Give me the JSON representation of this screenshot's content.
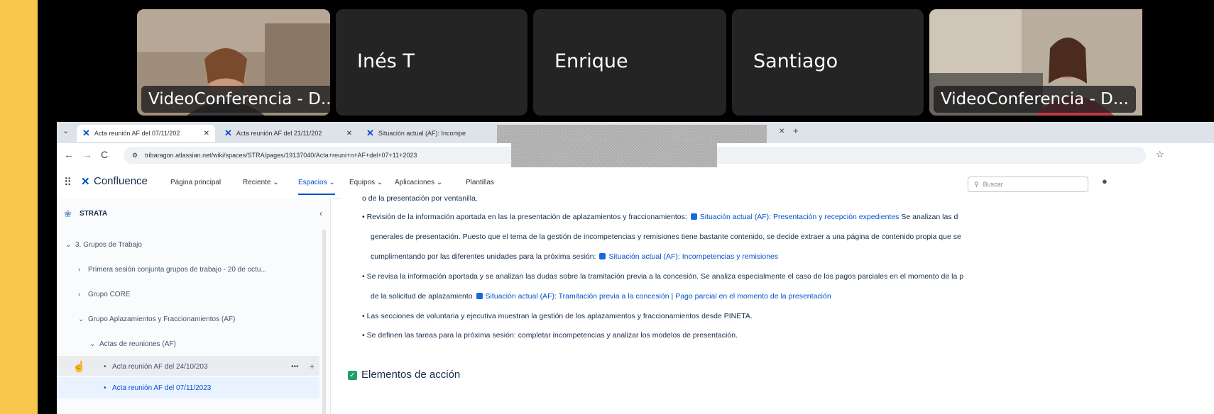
{
  "participants": [
    {
      "name": "VideoConferencia - D...",
      "has_video": true
    },
    {
      "name": "Inés T",
      "has_video": false
    },
    {
      "name": "Enrique",
      "has_video": false
    },
    {
      "name": "Santiago",
      "has_video": false
    },
    {
      "name": "VideoConferencia - D...",
      "has_video": true
    }
  ],
  "browser": {
    "tabs": [
      {
        "title": "Acta reunión AF del 07/11/202",
        "active": true
      },
      {
        "title": "Acta reunión AF del 21/11/202",
        "active": false
      },
      {
        "title": "Situación actual (AF): Incompe",
        "active": false
      }
    ],
    "url": "tribaragon.atlassian.net/wiki/spaces/STRA/pages/19137040/Acta+reuni+n+AF+del+07+11+2023"
  },
  "confluence": {
    "logo": "Confluence",
    "nav": [
      "Página principal",
      "Reciente ⌄",
      "Espacios ⌄",
      "Equipos ⌄",
      "Aplicaciones ⌄",
      "Plantillas"
    ],
    "search_placeholder": "Buscar"
  },
  "sidebar": {
    "space": "STRATA",
    "items": [
      "3. Grupos de Trabajo",
      "Primera sesión conjunta grupos de trabajo - 20 de octu...",
      "Grupo CORE",
      "Grupo Aplazamientos y Fraccionamientos (AF)",
      "Actas de reuniones (AF)",
      "Acta reunión AF del 24/10/203",
      "Acta reunión AF del 07/11/2023"
    ]
  },
  "content": {
    "cut_line": "o de la presentación por ventanilla.",
    "b1_pre": "Revisión de la información aportada en las la presentación de aplazamientos y fraccionamientos:",
    "b1_link": "Situación actual (AF): Presentación y recepción expedientes",
    "b1_post": "Se analizan las d",
    "b1_l2": "generales de presentación. Puesto que el tema de la gestión de incompetencias y remisiones tiene bastante contenido, se decide extraer a una página de contenido propia que se",
    "b1_l3": "cumplimentando por las diferentes unidades para la próxima sesión:",
    "b1_link2": "Situación actual (AF): Incompetencias y remisiones",
    "b2_l1": "Se revisa la información aportada y se analizan las dudas sobre la tramitación previa a la concesión. Se analiza especialmente el caso de los pagos parciales en el momento de la p",
    "b2_l2": "de la solicitud de aplazamiento",
    "b2_link": "Situación actual (AF): Tramitación previa a la concesión | Pago parcial en el momento de la presentación",
    "b3": "Las secciones de voluntaria y ejecutiva muestran la gestión de los aplazamientos y fraccionamientos desde PINETA.",
    "b4": "Se definen las tareas para la próxima sesión: completar incompetencias y analizar los modelos de presentación.",
    "section_title": "Elementos de acción"
  }
}
